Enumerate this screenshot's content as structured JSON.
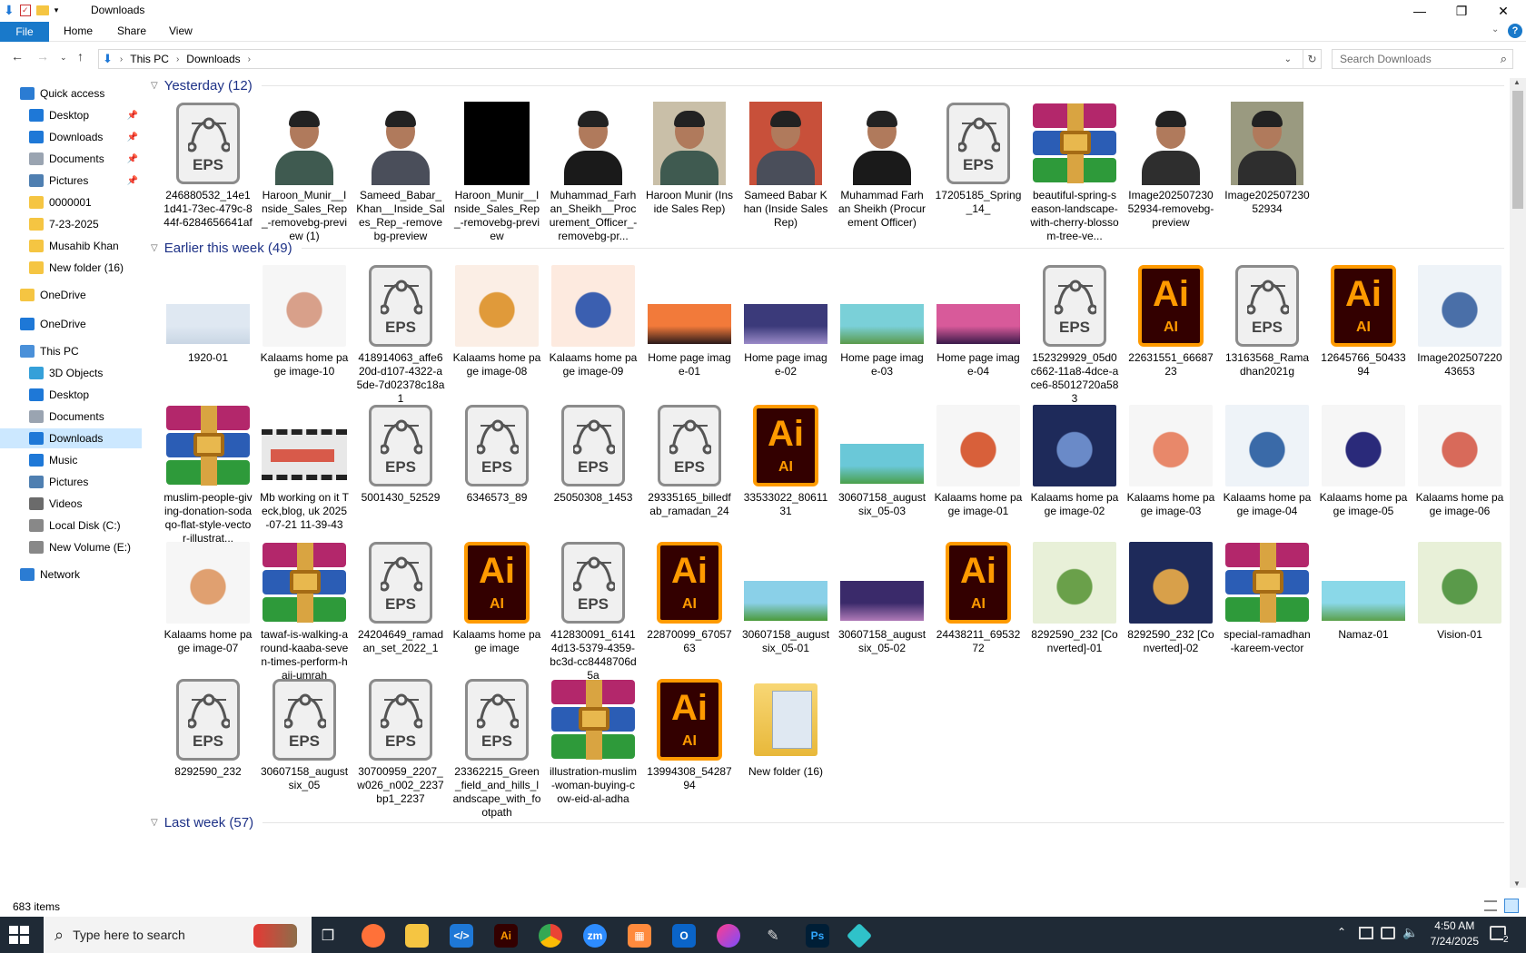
{
  "window": {
    "title": "Downloads",
    "minimize": "—",
    "maximize": "❐",
    "close": "✕"
  },
  "ribbon": {
    "tabs": [
      "File",
      "Home",
      "Share",
      "View"
    ]
  },
  "address": {
    "path": [
      "This PC",
      "Downloads"
    ],
    "search_placeholder": "Search Downloads"
  },
  "nav": {
    "items": [
      {
        "label": "Quick access",
        "icon": "star-icon",
        "color": "#2b7cd3",
        "level": 0
      },
      {
        "label": "Desktop",
        "icon": "desktop-icon",
        "color": "#1e78d7",
        "level": 1,
        "pinned": true
      },
      {
        "label": "Downloads",
        "icon": "download-icon",
        "color": "#1e78d7",
        "level": 1,
        "pinned": true
      },
      {
        "label": "Documents",
        "icon": "document-icon",
        "color": "#9aa4b1",
        "level": 1,
        "pinned": true
      },
      {
        "label": "Pictures",
        "icon": "pictures-icon",
        "color": "#4f7fb1",
        "level": 1,
        "pinned": true
      },
      {
        "label": "0000001",
        "icon": "folder-icon",
        "color": "#f5c542",
        "level": 1
      },
      {
        "label": "7-23-2025",
        "icon": "folder-icon",
        "color": "#f5c542",
        "level": 1
      },
      {
        "label": "Musahib Khan",
        "icon": "folder-icon",
        "color": "#f5c542",
        "level": 1
      },
      {
        "label": "New folder (16)",
        "icon": "folder-icon",
        "color": "#f5c542",
        "level": 1
      },
      {
        "label": "OneDrive",
        "icon": "folder-icon",
        "color": "#f5c542",
        "level": 0
      },
      {
        "label": "OneDrive",
        "icon": "cloud-icon",
        "color": "#1e78d7",
        "level": 0
      },
      {
        "label": "This PC",
        "icon": "pc-icon",
        "color": "#4a90d9",
        "level": 0
      },
      {
        "label": "3D Objects",
        "icon": "cube-icon",
        "color": "#35a0d9",
        "level": 1
      },
      {
        "label": "Desktop",
        "icon": "desktop-icon",
        "color": "#1e78d7",
        "level": 1
      },
      {
        "label": "Documents",
        "icon": "document-icon",
        "color": "#9aa4b1",
        "level": 1
      },
      {
        "label": "Downloads",
        "icon": "download-icon",
        "color": "#1e78d7",
        "level": 1,
        "selected": true
      },
      {
        "label": "Music",
        "icon": "music-icon",
        "color": "#1e78d7",
        "level": 1
      },
      {
        "label": "Pictures",
        "icon": "pictures-icon",
        "color": "#4f7fb1",
        "level": 1
      },
      {
        "label": "Videos",
        "icon": "video-icon",
        "color": "#6b6b6b",
        "level": 1
      },
      {
        "label": "Local Disk (C:)",
        "icon": "drive-icon",
        "color": "#888888",
        "level": 1
      },
      {
        "label": "New Volume (E:)",
        "icon": "drive-icon",
        "color": "#888888",
        "level": 1
      },
      {
        "label": "Network",
        "icon": "network-icon",
        "color": "#2b7cd3",
        "level": 0
      }
    ]
  },
  "groups": [
    {
      "title": "Yesterday (12)",
      "items": [
        {
          "label": "246880532_14e11d41-73ec-479c-844f-6284656641af",
          "type": "eps"
        },
        {
          "label": "Haroon_Munir__Inside_Sales_Rep_-removebg-preview (1)",
          "type": "photo",
          "bg": "#ffffff",
          "cloth": "#3f5a50"
        },
        {
          "label": "Sameed_Babar_Khan__Inside_Sales_Rep_-removebg-preview",
          "type": "photo",
          "bg": "#ffffff",
          "cloth": "#4a4e5a"
        },
        {
          "label": "Haroon_Munir__Inside_Sales_Rep_-removebg-preview",
          "type": "black"
        },
        {
          "label": "Muhammad_Farhan_Sheikh__Procurement_Officer_-removebg-pr...",
          "type": "photo",
          "bg": "#ffffff",
          "cloth": "#1a1a1a"
        },
        {
          "label": "Haroon Munir (Inside Sales Rep)",
          "type": "photo",
          "bg": "#c9bfa8",
          "cloth": "#3f5a50"
        },
        {
          "label": "Sameed Babar Khan (Inside Sales Rep)",
          "type": "photo",
          "bg": "#c8503a",
          "cloth": "#4a4e5a"
        },
        {
          "label": "Muhammad Farhan Sheikh (Procurement Officer)",
          "type": "photo",
          "bg": "#ffffff",
          "cloth": "#1a1a1a"
        },
        {
          "label": "17205185_Spring_14_",
          "type": "eps"
        },
        {
          "label": "beautiful-spring-season-landscape-with-cherry-blossom-tree-ve...",
          "type": "rar"
        },
        {
          "label": "Image20250723052934-removebg-preview",
          "type": "photo",
          "bg": "#ffffff",
          "cloth": "#2e2e2e"
        },
        {
          "label": "Image20250723052934",
          "type": "photo",
          "bg": "#9a9a80",
          "cloth": "#2e2e2e"
        }
      ]
    },
    {
      "title": "Earlier this week (49)",
      "items": [
        {
          "label": "1920-01",
          "type": "wide",
          "c1": "#dfe8f2",
          "c2": "#c9d6e4"
        },
        {
          "label": "Kalaams home page image-10",
          "type": "ill",
          "c1": "#f6f6f6",
          "c2": "#d8a08a"
        },
        {
          "label": "418914063_affe620d-d107-4322-a5de-7d02378c18a1",
          "type": "eps"
        },
        {
          "label": "Kalaams home page image-08",
          "type": "ill",
          "c1": "#fbeee5",
          "c2": "#e09a3a"
        },
        {
          "label": "Kalaams home page image-09",
          "type": "ill",
          "c1": "#fdeadf",
          "c2": "#3b5fb0"
        },
        {
          "label": "Home page image-01",
          "type": "wide",
          "c1": "#f27a3a",
          "c2": "#2b1a1a"
        },
        {
          "label": "Home page image-02",
          "type": "wide",
          "c1": "#3b3a7a",
          "c2": "#9a8ac8"
        },
        {
          "label": "Home page image-03",
          "type": "wide",
          "c1": "#7ad0d8",
          "c2": "#5a9a4a"
        },
        {
          "label": "Home page image-04",
          "type": "wide",
          "c1": "#d85a9a",
          "c2": "#3a1a4a"
        },
        {
          "label": "152329929_05d0c662-11a8-4dce-ace6-85012720a583",
          "type": "eps"
        },
        {
          "label": "22631551_6668723",
          "type": "ai"
        },
        {
          "label": "13163568_Ramadhan2021g",
          "type": "eps"
        },
        {
          "label": "12645766_5043394",
          "type": "ai"
        },
        {
          "label": "Image20250722043653",
          "type": "ill",
          "c1": "#eef3f8",
          "c2": "#4a6fa8"
        },
        {
          "label": "muslim-people-giving-donation-sodaqo-flat-style-vector-illustrat...",
          "type": "rar"
        },
        {
          "label": "Mb working on it Teck,blog, uk 2025-07-21 11-39-43",
          "type": "video"
        },
        {
          "label": "5001430_52529",
          "type": "eps"
        },
        {
          "label": "6346573_89",
          "type": "eps"
        },
        {
          "label": "25050308_1453",
          "type": "eps"
        },
        {
          "label": "29335165_billedfab_ramadan_24",
          "type": "eps"
        },
        {
          "label": "33533022_8061131",
          "type": "ai"
        },
        {
          "label": "30607158_augustsix_05-03",
          "type": "wide",
          "c1": "#6ac8d8",
          "c2": "#4aa04a"
        },
        {
          "label": "Kalaams home page image-01",
          "type": "ill",
          "c1": "#f6f6f6",
          "c2": "#d8603a"
        },
        {
          "label": "Kalaams home page image-02",
          "type": "ill",
          "c1": "#1e2a5a",
          "c2": "#6a8ac8"
        },
        {
          "label": "Kalaams home page image-03",
          "type": "ill",
          "c1": "#f6f6f6",
          "c2": "#e8886a"
        },
        {
          "label": "Kalaams home page image-04",
          "type": "ill",
          "c1": "#eef3f8",
          "c2": "#3a6aa8"
        },
        {
          "label": "Kalaams home page image-05",
          "type": "ill",
          "c1": "#f6f6f6",
          "c2": "#2a2a7a"
        },
        {
          "label": "Kalaams home page image-06",
          "type": "ill",
          "c1": "#f6f6f6",
          "c2": "#d86a5a"
        },
        {
          "label": "Kalaams home page image-07",
          "type": "ill",
          "c1": "#f6f6f6",
          "c2": "#e0a070"
        },
        {
          "label": "tawaf-is-walking-around-kaaba-seven-times-perform-hajj-umrah",
          "type": "rar"
        },
        {
          "label": "24204649_ramadan_set_2022_1",
          "type": "eps"
        },
        {
          "label": "Kalaams home page image",
          "type": "ai"
        },
        {
          "label": "412830091_61414d13-5379-4359-bc3d-cc8448706d5a",
          "type": "eps"
        },
        {
          "label": "22870099_6705763",
          "type": "ai"
        },
        {
          "label": "30607158_augustsix_05-01",
          "type": "wide",
          "c1": "#8ad0e8",
          "c2": "#4a9a3a"
        },
        {
          "label": "30607158_augustsix_05-02",
          "type": "wide",
          "c1": "#3a2a6a",
          "c2": "#b07ab8"
        },
        {
          "label": "24438211_6953272",
          "type": "ai"
        },
        {
          "label": "8292590_232 [Converted]-01",
          "type": "ill",
          "c1": "#e8f0d8",
          "c2": "#6aa04a"
        },
        {
          "label": "8292590_232 [Converted]-02",
          "type": "ill",
          "c1": "#1e2a5a",
          "c2": "#d8a04a"
        },
        {
          "label": "special-ramadhan-kareem-vector",
          "type": "rar"
        },
        {
          "label": "Namaz-01",
          "type": "wide",
          "c1": "#8ad8e8",
          "c2": "#5aa04a"
        },
        {
          "label": "Vision-01",
          "type": "ill",
          "c1": "#e8f0d8",
          "c2": "#5a9a4a"
        },
        {
          "label": "8292590_232",
          "type": "eps"
        },
        {
          "label": "30607158_augustsix_05",
          "type": "eps"
        },
        {
          "label": "30700959_2207_w026_n002_2237bp1_2237",
          "type": "eps"
        },
        {
          "label": "23362215_Green_field_and_hills_landscape_with_footpath",
          "type": "eps"
        },
        {
          "label": "illustration-muslim-woman-buying-cow-eid-al-adha",
          "type": "rar"
        },
        {
          "label": "13994308_5428794",
          "type": "ai"
        },
        {
          "label": "New folder (16)",
          "type": "folder"
        }
      ]
    },
    {
      "title": "Last week (57)",
      "items": []
    }
  ],
  "status": {
    "count": "683 items"
  },
  "taskbar": {
    "search_placeholder": "Type here to search",
    "time": "4:50 AM",
    "date": "7/24/2025",
    "notifications": "2"
  }
}
